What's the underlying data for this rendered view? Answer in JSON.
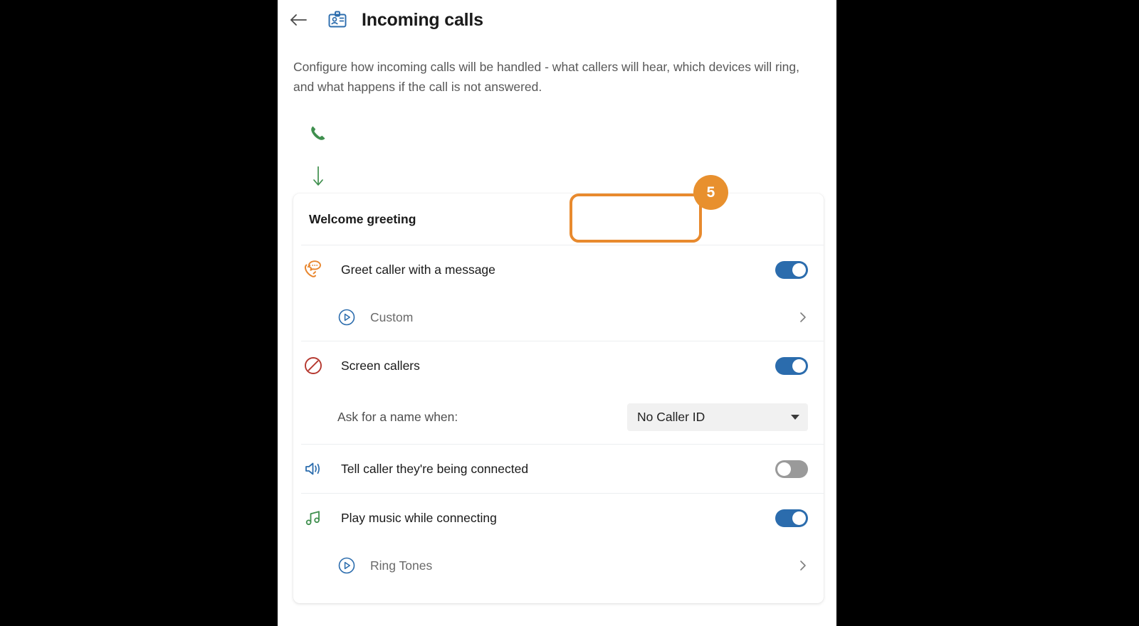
{
  "header": {
    "back_label": "back-arrow",
    "icon": "id-badge-icon",
    "title": "Incoming calls"
  },
  "description": "Configure how incoming calls will be handled - what callers will hear, which devices will ring, and what happens if the call is not answered.",
  "flow": {
    "phone_icon": "phone-icon",
    "arrow_icon": "arrow-down-icon"
  },
  "highlight": {
    "step_number": "5",
    "accent_color": "#e8902e"
  },
  "card": {
    "title": "Welcome greeting",
    "rows": [
      {
        "icon": "phone-message-icon",
        "label": "Greet caller with a message",
        "toggle_state": "on",
        "sub": {
          "icon": "play-circle-icon",
          "label": "Custom",
          "chevron": "chevron-right-icon"
        }
      },
      {
        "icon": "no-entry-icon",
        "label": "Screen callers",
        "toggle_state": "on",
        "select": {
          "label": "Ask for a name when:",
          "value": "No Caller ID",
          "caret": "caret-down-icon"
        }
      },
      {
        "icon": "speaker-icon",
        "label": "Tell caller they're being connected",
        "toggle_state": "off"
      },
      {
        "icon": "music-note-icon",
        "label": "Play music while connecting",
        "toggle_state": "on",
        "sub": {
          "icon": "play-circle-icon",
          "label": "Ring Tones",
          "chevron": "chevron-right-icon"
        }
      }
    ]
  },
  "colors": {
    "toggle_on": "#2b6cad",
    "toggle_off": "#9a9a9a",
    "accent_orange": "#e8902e",
    "green": "#3f8f4e",
    "red": "#b5382f",
    "blue": "#2b6cad"
  }
}
